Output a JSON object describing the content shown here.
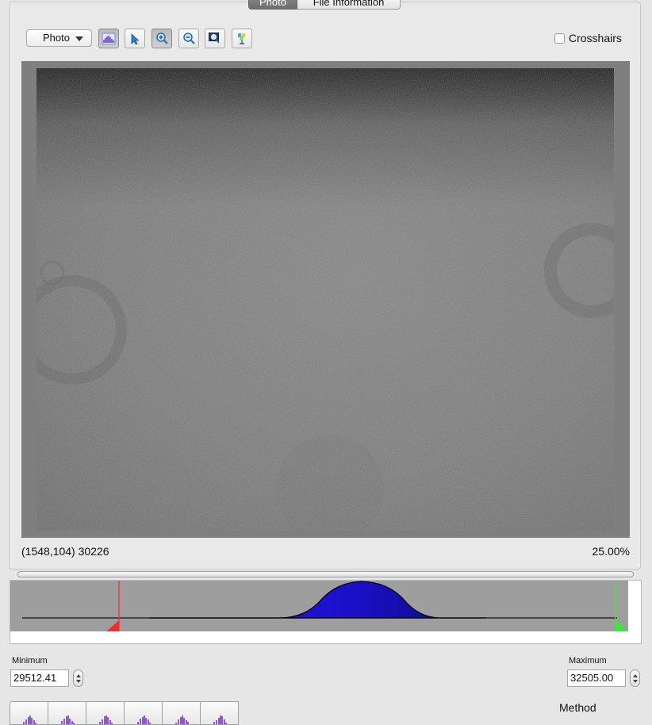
{
  "tabs": [
    {
      "label": "Photo",
      "active": true
    },
    {
      "label": "File Information",
      "active": false
    }
  ],
  "toolbar": {
    "view_popup": {
      "selected": "Photo"
    },
    "tools": [
      {
        "icon": "histogram-icon",
        "pressed": true
      },
      {
        "icon": "arrow-pointer-icon",
        "pressed": false
      },
      {
        "icon": "zoom-in-icon",
        "pressed": true
      },
      {
        "icon": "zoom-out-icon",
        "pressed": false
      },
      {
        "icon": "zoom-to-fit-icon",
        "pressed": false
      },
      {
        "icon": "color-picker-icon",
        "pressed": false
      }
    ],
    "crosshairs": {
      "label": "Crosshairs",
      "checked": false
    }
  },
  "status": {
    "coordinates": "(1548,104) 30226",
    "zoom": "25.00%"
  },
  "histogram": {
    "colors": {
      "fill": "#1a13d8",
      "min_marker": "#ff2b2b",
      "max_marker": "#33ee33",
      "background": "#9e9e9e"
    }
  },
  "levels": {
    "minimum": {
      "label": "Minimum",
      "value": "29512.41"
    },
    "maximum": {
      "label": "Maximum",
      "value": "32505.00"
    }
  },
  "method": {
    "label": "Method"
  },
  "method_buttons_count": 6
}
